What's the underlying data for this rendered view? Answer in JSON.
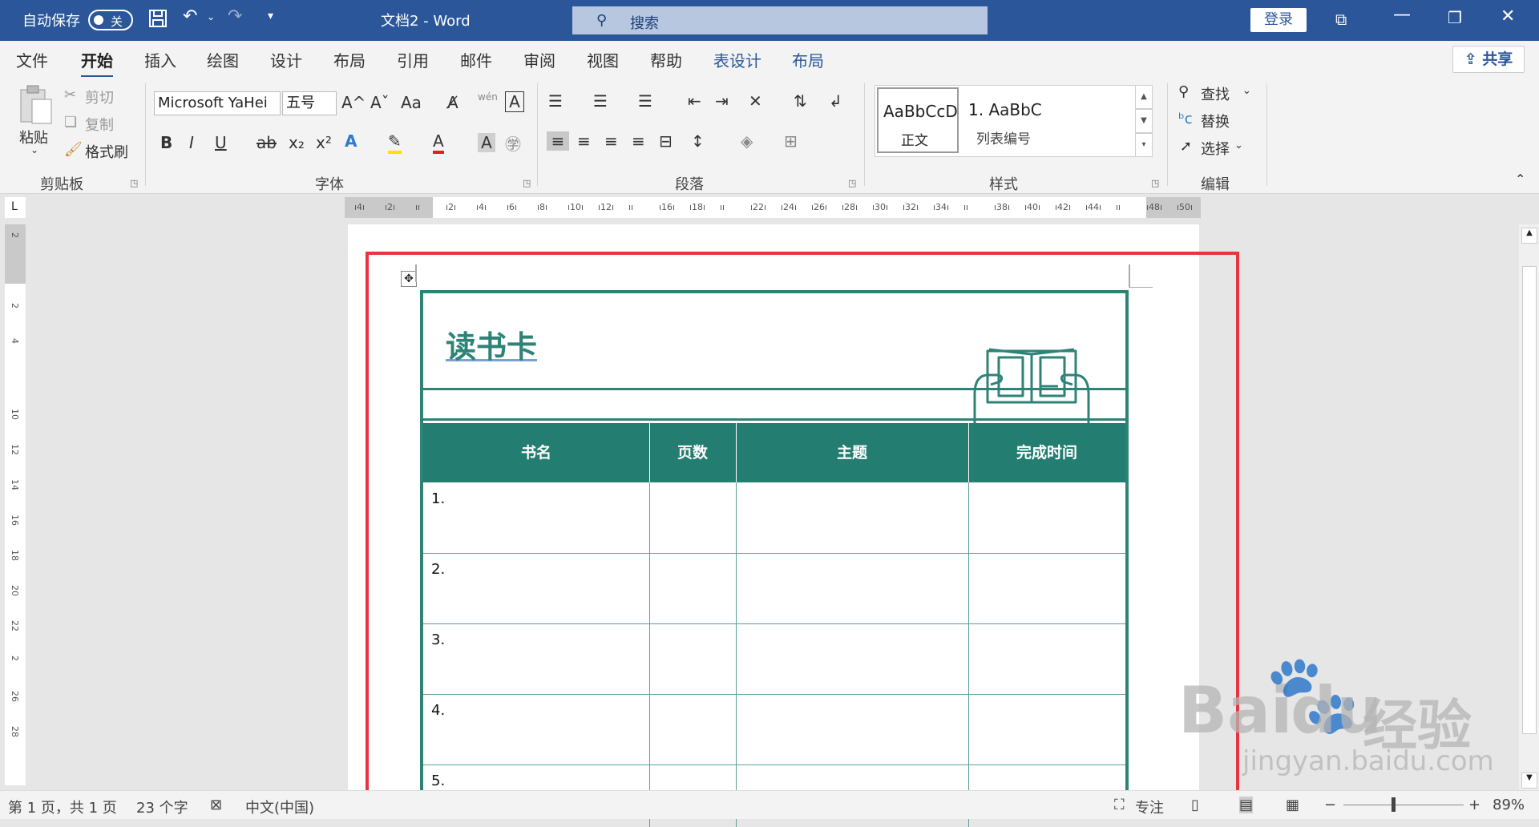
{
  "titlebar": {
    "autosave_label": "自动保存",
    "autosave_state": "关",
    "doc_title": "文档2  -  Word",
    "search_placeholder": "搜索",
    "login_label": "登录"
  },
  "tabs": [
    "文件",
    "开始",
    "插入",
    "绘图",
    "设计",
    "布局",
    "引用",
    "邮件",
    "审阅",
    "视图",
    "帮助",
    "表设计",
    "布局"
  ],
  "active_tab": "开始",
  "share_label": "共享",
  "ribbon": {
    "clipboard": {
      "paste": "粘贴",
      "cut": "剪切",
      "copy": "复制",
      "format_painter": "格式刷",
      "label": "剪贴板"
    },
    "font": {
      "family": "Microsoft YaHei",
      "size": "五号",
      "label": "字体",
      "bold": "B",
      "italic": "I",
      "underline": "U",
      "strike": "ab",
      "sub": "x₂",
      "sup": "x²",
      "case": "Aa",
      "grow": "A^",
      "shrink": "Aˇ"
    },
    "paragraph": {
      "label": "段落"
    },
    "styles": {
      "normal_preview": "AaBbCcD",
      "normal_name": "正文",
      "list_preview": "1.  AaBbC",
      "list_name": "列表编号",
      "label": "样式"
    },
    "editing": {
      "find": "查找",
      "replace": "替换",
      "select": "选择",
      "label": "编辑"
    }
  },
  "ruler_h": [
    "4",
    "2",
    "",
    "2",
    "4",
    "6",
    "8",
    "10",
    "12",
    "",
    "16",
    "18",
    "",
    "22",
    "24",
    "26",
    "28",
    "30",
    "32",
    "34",
    "",
    "38",
    "40",
    "42",
    "44",
    "",
    "48",
    "50"
  ],
  "ruler_v": [
    "2",
    "",
    "2",
    "4",
    "",
    "10",
    "12",
    "14",
    "16",
    "18",
    "20",
    "22",
    "2",
    "26",
    "28"
  ],
  "document": {
    "card_title": "读书卡",
    "columns": [
      "书名",
      "页数",
      "主题",
      "完成时间"
    ],
    "rows": [
      "1.",
      "2.",
      "3.",
      "4.",
      "5."
    ]
  },
  "statusbar": {
    "page": "第 1 页，共 1 页",
    "words": "23 个字",
    "language": "中文(中国)",
    "focus": "专注",
    "zoom": "89%"
  },
  "watermark": {
    "brand": "Bai",
    "brand2": "du",
    "brand_cn": "经验",
    "url": "jingyan.baidu.com"
  },
  "colors": {
    "titlebar": "#2b579a",
    "card_accent": "#2e8377",
    "highlight_box": "#e8343c"
  }
}
